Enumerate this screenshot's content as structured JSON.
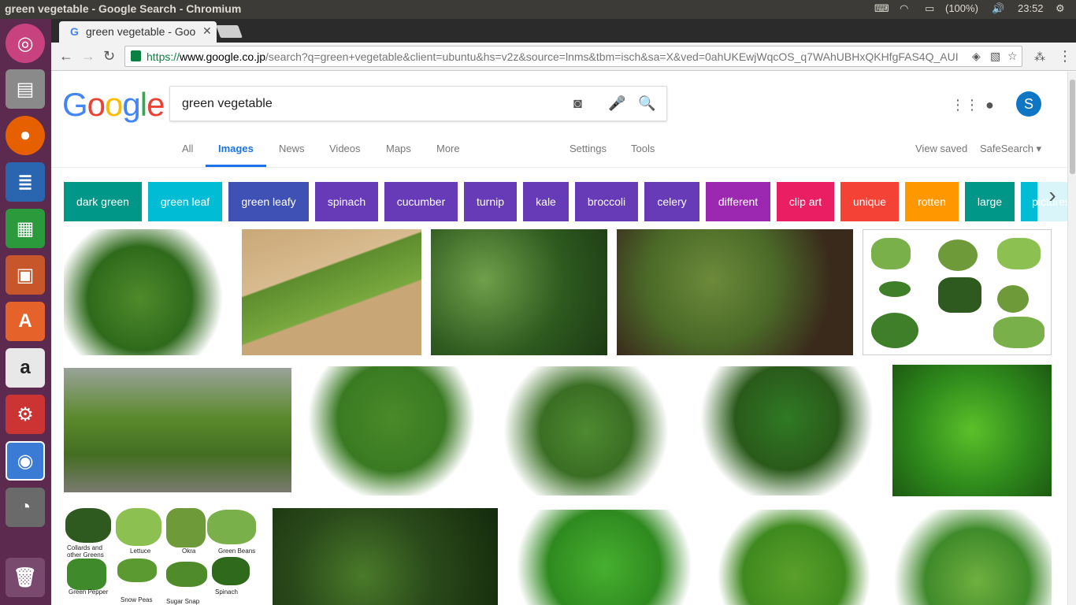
{
  "os": {
    "window_title": "green vegetable - Google Search - Chromium",
    "battery": "(100%)",
    "clock": "23:52"
  },
  "browser": {
    "tab_title": "green vegetable - Google Search",
    "url_scheme": "https://",
    "url_host": "www.google.co.jp",
    "url_rest": "/search?q=green+vegetable&client=ubuntu&hs=v2z&source=lnms&tbm=isch&sa=X&ved=0ahUKEwjWqcOS_q7WAhUBHxQKHfgFAS4Q_AUI"
  },
  "search": {
    "logo_letters": [
      "G",
      "o",
      "o",
      "g",
      "l",
      "e"
    ],
    "query": "green vegetable",
    "account_initial": "S"
  },
  "nav": {
    "tabs": [
      "All",
      "Images",
      "News",
      "Videos",
      "Maps",
      "More"
    ],
    "active_tab": "Images",
    "settings": "Settings",
    "tools": "Tools",
    "view_saved": "View saved",
    "safesearch": "SafeSearch"
  },
  "chips": [
    {
      "label": "dark green",
      "color": "#009688"
    },
    {
      "label": "green leaf",
      "color": "#00bcd4"
    },
    {
      "label": "green leafy",
      "color": "#3f51b5"
    },
    {
      "label": "spinach",
      "color": "#673ab7"
    },
    {
      "label": "cucumber",
      "color": "#673ab7"
    },
    {
      "label": "turnip",
      "color": "#673ab7"
    },
    {
      "label": "kale",
      "color": "#673ab7"
    },
    {
      "label": "broccoli",
      "color": "#673ab7"
    },
    {
      "label": "celery",
      "color": "#673ab7"
    },
    {
      "label": "different",
      "color": "#9c27b0"
    },
    {
      "label": "clip art",
      "color": "#e91e63"
    },
    {
      "label": "unique",
      "color": "#f44336"
    },
    {
      "label": "rotten",
      "color": "#ff9800"
    },
    {
      "label": "large",
      "color": "#009688"
    },
    {
      "label": "pictures",
      "color": "#00bcd4"
    }
  ],
  "image_descriptions": {
    "row3_chart_labels": [
      "Collards and other Greens",
      "Lettuce",
      "Okra",
      "Green Beans",
      "Green Pepper",
      "Snow Peas",
      "Sugar Snap Peas",
      "Spinach"
    ]
  }
}
